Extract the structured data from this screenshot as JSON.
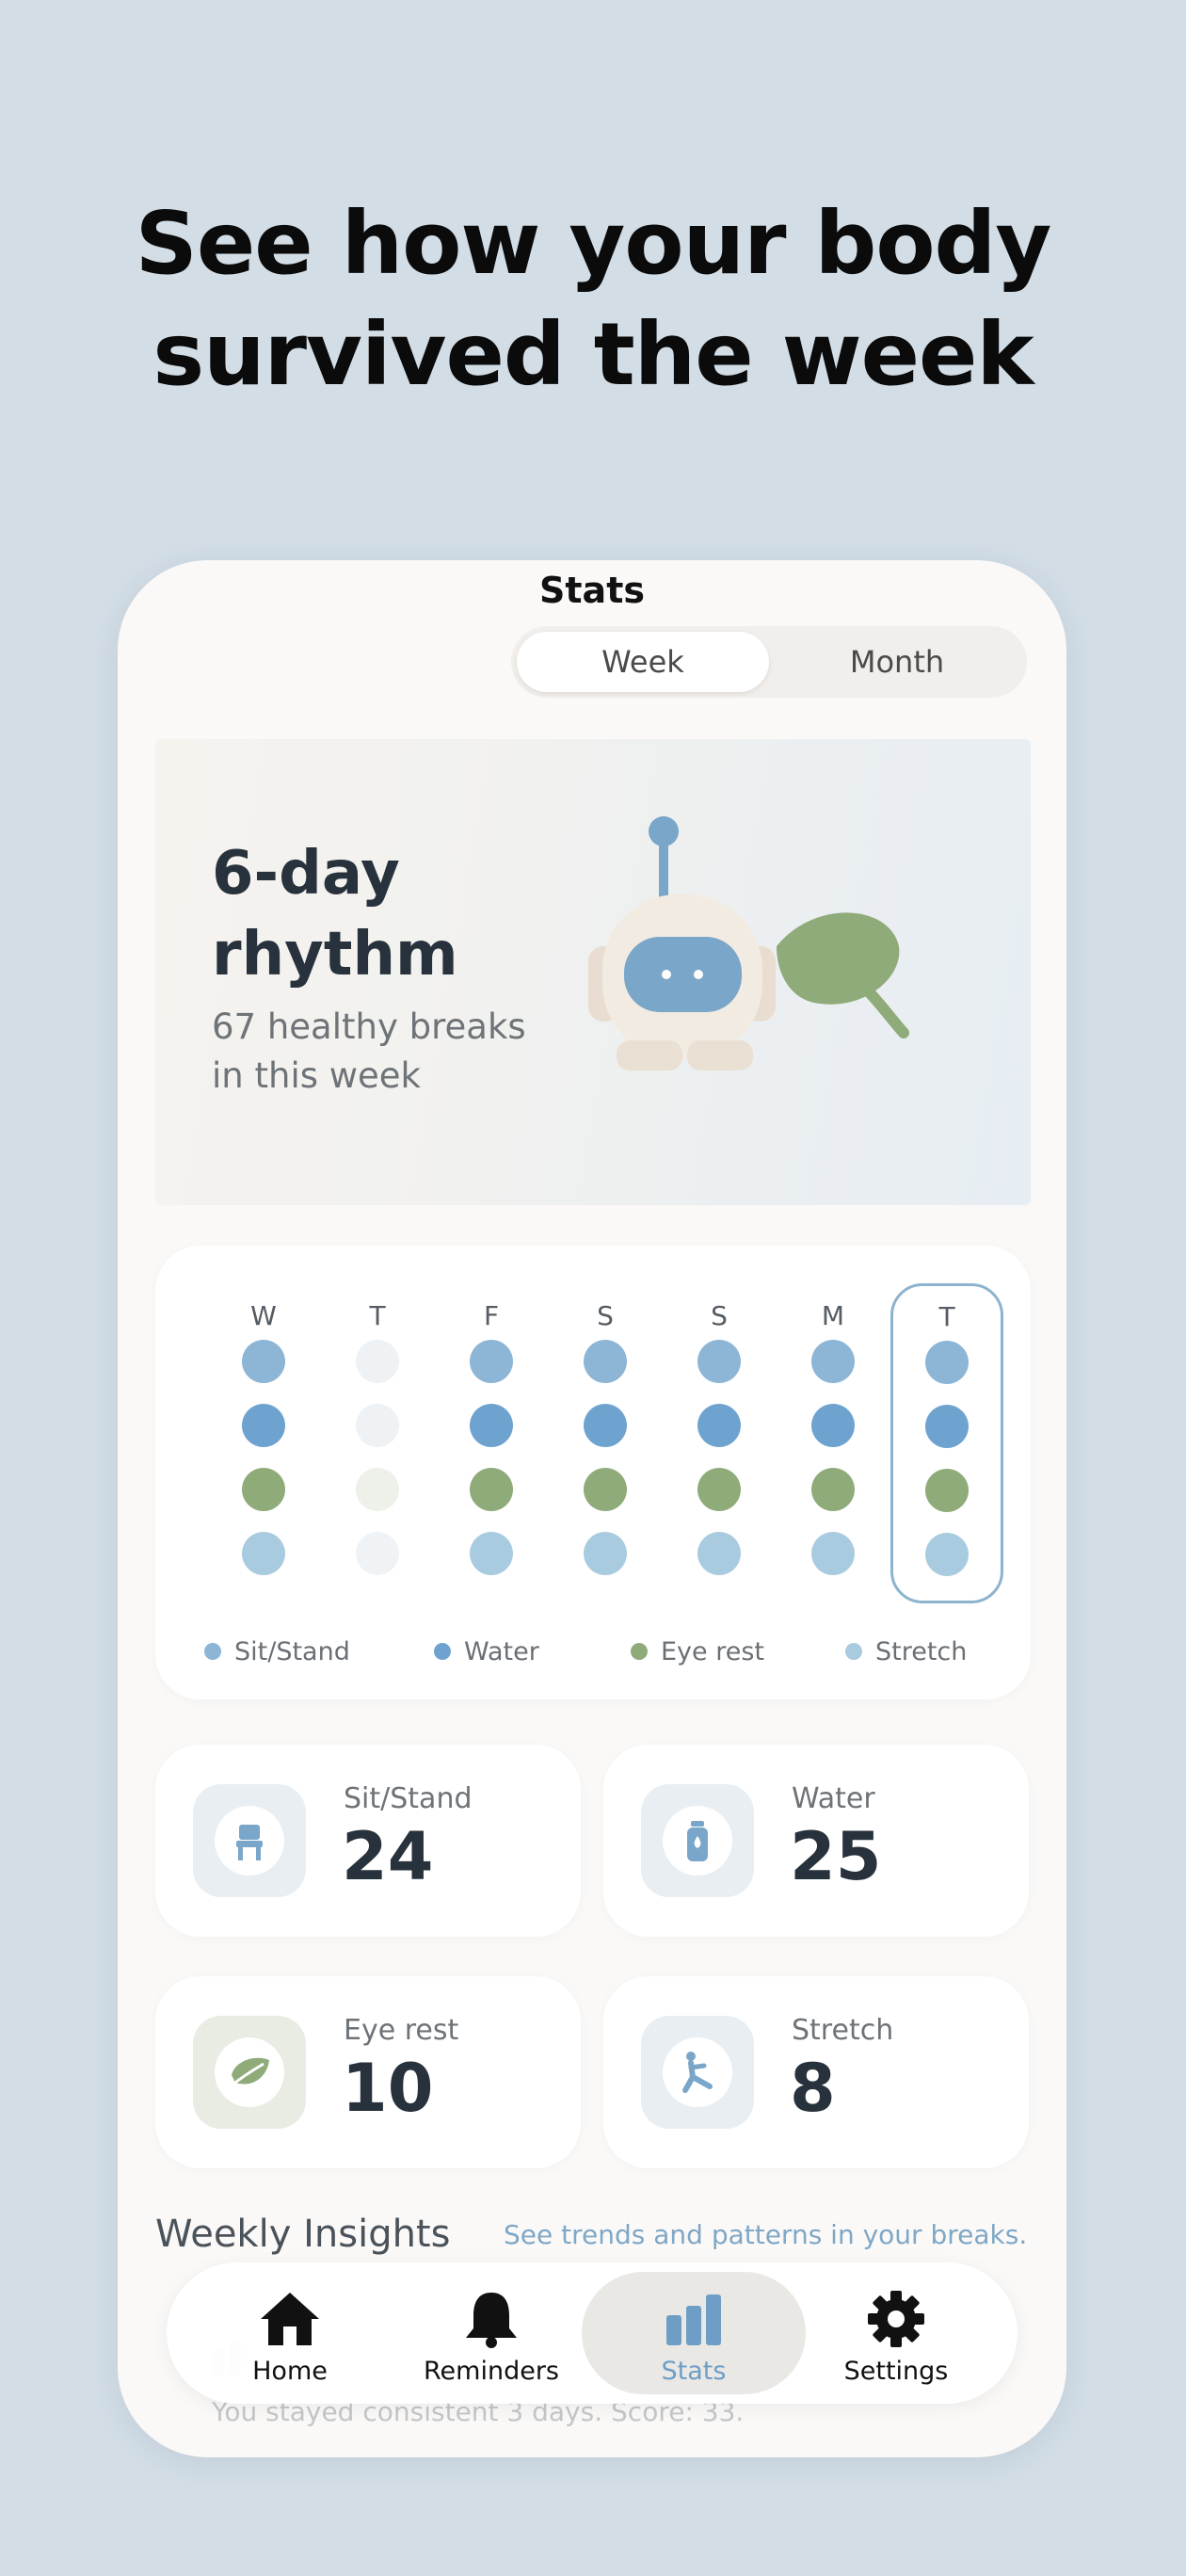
{
  "headline": {
    "line1": "See how your body",
    "line2": "survived the week"
  },
  "screen": {
    "title": "Stats"
  },
  "segmented": {
    "options": [
      "Week",
      "Month"
    ],
    "selected": "Week"
  },
  "hero": {
    "title_line1": "6-day",
    "title_line2": "rhythm",
    "sub_line1": "67 healthy breaks",
    "sub_line2": "in this week",
    "mascot_icon": "robot-leaf-mascot"
  },
  "week": {
    "days": [
      {
        "label": "W",
        "active": true,
        "today": false
      },
      {
        "label": "T",
        "active": false,
        "today": false
      },
      {
        "label": "F",
        "active": true,
        "today": false
      },
      {
        "label": "S",
        "active": true,
        "today": false
      },
      {
        "label": "S",
        "active": true,
        "today": false
      },
      {
        "label": "M",
        "active": true,
        "today": false
      },
      {
        "label": "T",
        "active": true,
        "today": true
      }
    ],
    "legend": [
      "Sit/Stand",
      "Water",
      "Eye rest",
      "Stretch"
    ],
    "colors": [
      "#8cb5d6",
      "#6fa3cf",
      "#8fab79",
      "#a9cbe0"
    ],
    "faded_colors": [
      "#eef2f5",
      "#eef2f5",
      "#eef0ea",
      "#f0f3f5"
    ]
  },
  "stats": [
    {
      "label": "Sit/Stand",
      "value": "24",
      "icon": "chair-icon"
    },
    {
      "label": "Water",
      "value": "25",
      "icon": "water-bottle-icon"
    },
    {
      "label": "Eye rest",
      "value": "10",
      "icon": "leaf-icon"
    },
    {
      "label": "Stretch",
      "value": "8",
      "icon": "stretch-icon"
    }
  ],
  "insights": {
    "title": "Weekly Insights",
    "subtitle": "See trends and patterns in your breaks.",
    "faded_text": "You stayed consistent 3 days. Score: 33."
  },
  "tabbar": {
    "tabs": [
      {
        "label": "Home",
        "icon": "home-icon"
      },
      {
        "label": "Reminders",
        "icon": "bell-icon"
      },
      {
        "label": "Stats",
        "icon": "bar-chart-icon"
      },
      {
        "label": "Settings",
        "icon": "gear-icon"
      }
    ],
    "active": "Stats",
    "accent": "#6e9ec5"
  }
}
